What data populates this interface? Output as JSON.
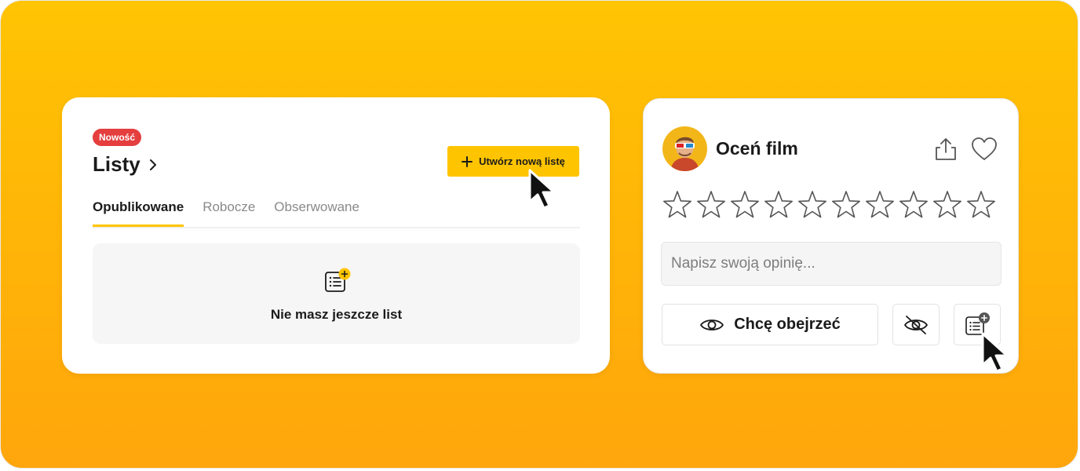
{
  "lists_card": {
    "badge": "Nowość",
    "title": "Listy",
    "create_button": "Utwórz nową listę",
    "tabs": [
      {
        "label": "Opublikowane",
        "active": true
      },
      {
        "label": "Robocze",
        "active": false
      },
      {
        "label": "Obserwowane",
        "active": false
      }
    ],
    "empty_message": "Nie masz jeszcze list"
  },
  "rate_card": {
    "title": "Oceń film",
    "rating_max": 10,
    "rating_value": 0,
    "opinion_placeholder": "Napisz swoją opinię...",
    "want_to_watch_button": "Chcę obejrzeć"
  },
  "colors": {
    "accent": "#ffc400",
    "badge": "#e53e3e",
    "background_top": "#ffc403",
    "background_bottom": "#ffa60c"
  },
  "icons": [
    "chevron-right-icon",
    "plus-icon",
    "list-add-icon",
    "share-icon",
    "heart-icon",
    "star-icon",
    "eye-icon",
    "eye-off-icon",
    "cursor-arrow-icon"
  ]
}
